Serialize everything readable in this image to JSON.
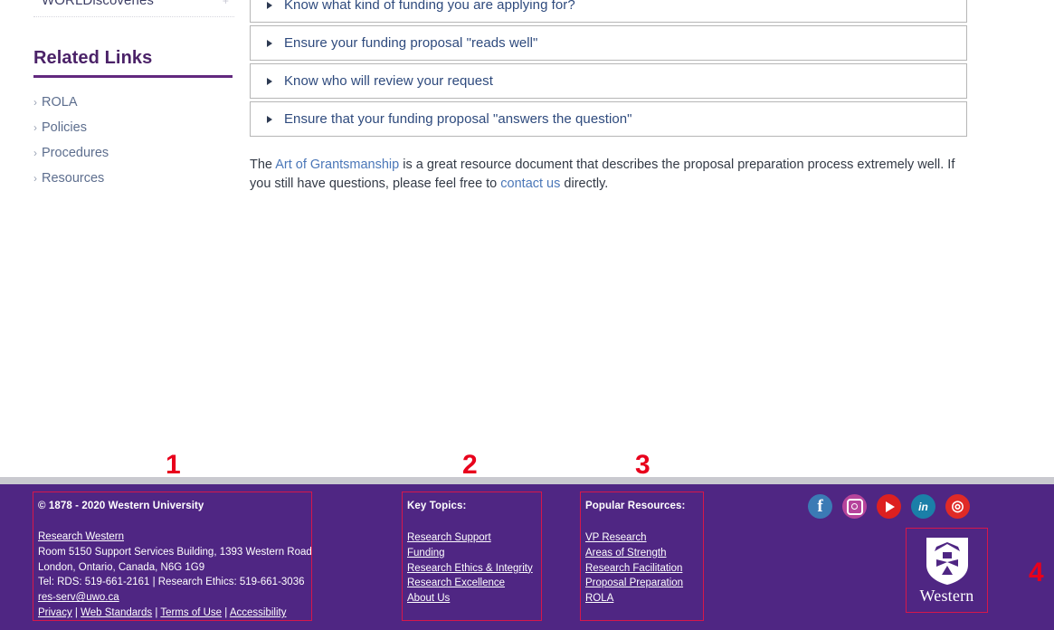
{
  "sidebar": {
    "trailing_nav_item": "WORLDiscoveries",
    "expand_icon": "plus-icon",
    "related": {
      "heading": "Related Links",
      "items": [
        {
          "label": "ROLA"
        },
        {
          "label": "Policies"
        },
        {
          "label": "Procedures"
        },
        {
          "label": "Resources"
        }
      ]
    }
  },
  "main": {
    "accordion": [
      {
        "label": "Know what kind of funding you are applying for?"
      },
      {
        "label": "Ensure your funding proposal \"reads well\""
      },
      {
        "label": "Know who will review your request"
      },
      {
        "label": "Ensure that your funding proposal \"answers the question\""
      }
    ],
    "paragraph": {
      "part1": "The ",
      "link1": "Art of Grantsmanship",
      "part2": " is a great resource document that describes the proposal preparation process extremely well. If you still have questions, please feel free to ",
      "link2": "contact us",
      "part3": " directly."
    }
  },
  "footer": {
    "copyright": "© 1878 - 2020 Western University",
    "address": {
      "org_link": "Research Western",
      "line1": "Room 5150 Support Services Building, 1393 Western Road",
      "line2": "London, Ontario, Canada, N6G 1G9",
      "line3": "Tel: RDS: 519-661-2161 | Research Ethics: 519-661-3036",
      "email": "res-serv@uwo.ca"
    },
    "legal_links": [
      {
        "label": "Privacy"
      },
      {
        "label": "Web Standards"
      },
      {
        "label": "Terms of Use"
      },
      {
        "label": "Accessibility"
      }
    ],
    "legal_separator": " | ",
    "key_topics": {
      "heading": "Key Topics:",
      "items": [
        {
          "label": "Research Support"
        },
        {
          "label": "Funding"
        },
        {
          "label": "Research Ethics & Integrity"
        },
        {
          "label": "Research Excellence"
        },
        {
          "label": "About Us"
        }
      ]
    },
    "popular_resources": {
      "heading": "Popular Resources:",
      "items": [
        {
          "label": "VP Research"
        },
        {
          "label": "Areas of Strength"
        },
        {
          "label": "Research Facilitation"
        },
        {
          "label": "Proposal Preparation"
        },
        {
          "label": "ROLA"
        }
      ]
    },
    "social": [
      {
        "name": "facebook-icon",
        "glyph": "f"
      },
      {
        "name": "instagram-icon",
        "glyph": ""
      },
      {
        "name": "youtube-icon",
        "glyph": ""
      },
      {
        "name": "linkedin-icon",
        "glyph": "in"
      },
      {
        "name": "weibo-icon",
        "glyph": "◎"
      }
    ],
    "logo": {
      "wordmark": "Western"
    }
  },
  "annotations": [
    {
      "number": "1"
    },
    {
      "number": "2"
    },
    {
      "number": "3"
    },
    {
      "number": "4"
    }
  ],
  "colors": {
    "brand_purple": "#4f2683",
    "heading_purple": "#4b2268",
    "link_blue": "#2e4a7d",
    "annotation_red": "#e8001c",
    "divider_grey": "#c9c9cf"
  }
}
